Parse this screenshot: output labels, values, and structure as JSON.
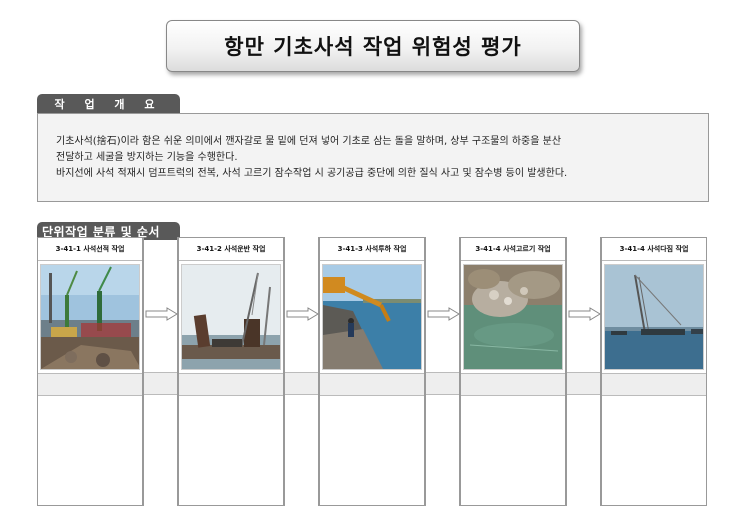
{
  "title": "항만 기초사석 작업 위험성 평가",
  "overview": {
    "tab_label": "작 업 개 요",
    "line1": "기초사석(捨石)이라 함은 쉬운 의미에서 깬자갈로 물 밑에 던져 넣어 기초로 삼는 돌을 말하며, 상부 구조물의 하중을 분산",
    "line2": "전달하고 세굴을 방지하는 기능을 수행한다.",
    "line3": "바지선에 사석 적재시 덤프트럭의 전복, 사석 고르기 잠수작업 시 공기공급 중단에 의한 질식 사고 및 잠수병 등이 발생한다."
  },
  "tasks": {
    "tab_label": "단위작업 분류 및 순서",
    "steps": [
      {
        "label": "3-41-1 사석선적 작업",
        "icon": "loading-dock-photo"
      },
      {
        "label": "3-41-2 사석운반 작업",
        "icon": "barge-crane-photo"
      },
      {
        "label": "3-41-3 사석투하 작업",
        "icon": "excavator-dumping-photo"
      },
      {
        "label": "3-41-4 사석고르기 작업",
        "icon": "underwater-rubble-photo"
      },
      {
        "label": "3-41-4 사석다짐 작업",
        "icon": "crane-barge-sea-photo"
      }
    ]
  },
  "colors": {
    "tab_bg": "#595959",
    "box_bg": "#f3f3f3",
    "band_bg": "#eeeeee"
  }
}
